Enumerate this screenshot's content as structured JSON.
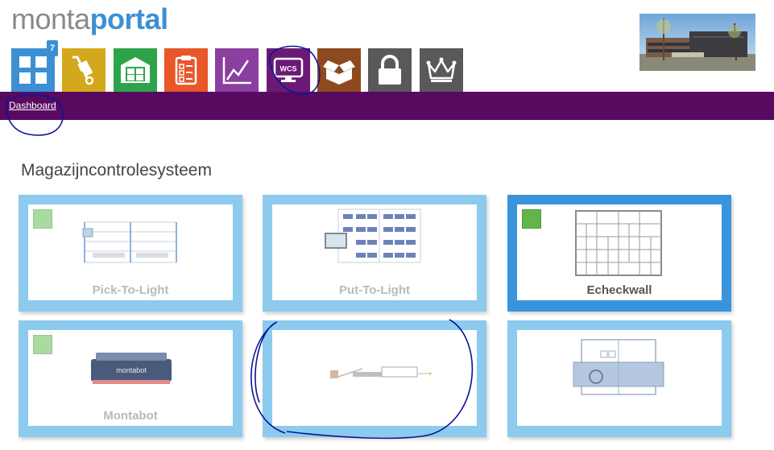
{
  "logo": {
    "part1": "monta",
    "part2": "portal"
  },
  "nav": {
    "badge_count": "7",
    "tiles": [
      {
        "name": "dashboard",
        "icon": "grid-icon",
        "color": "#3d8fd3"
      },
      {
        "name": "inbound",
        "icon": "hand-truck-icon",
        "color": "#d4a81c"
      },
      {
        "name": "warehouse",
        "icon": "warehouse-icon",
        "color": "#2ea44a"
      },
      {
        "name": "orders",
        "icon": "clipboard-checklist-icon",
        "color": "#e8562a"
      },
      {
        "name": "reports",
        "icon": "line-chart-icon",
        "color": "#8b3fa0"
      },
      {
        "name": "wcs",
        "icon": "monitor-wcs-icon",
        "color": "#6a1a75",
        "text": "WCS"
      },
      {
        "name": "packaging",
        "icon": "open-box-icon",
        "color": "#8e4a1e"
      },
      {
        "name": "security",
        "icon": "lock-icon",
        "color": "#595959"
      },
      {
        "name": "premium",
        "icon": "crown-icon",
        "color": "#595959"
      }
    ]
  },
  "breadcrumb": {
    "label": "Dashboard"
  },
  "section": {
    "title": "Magazijncontrolesysteem"
  },
  "cards": [
    {
      "label": "Pick-To-Light",
      "indicator": "inactive"
    },
    {
      "label": "Put-To-Light",
      "indicator": "none"
    },
    {
      "label": "Echeckwall",
      "indicator": "active"
    },
    {
      "label": "Montabot",
      "indicator": "inactive",
      "robot_text": "montabot"
    },
    {
      "label": "",
      "indicator": "none"
    },
    {
      "label": "",
      "indicator": "none"
    }
  ],
  "colors": {
    "nav_bar": "#580a60",
    "card_border": "#8ccaee",
    "card_border_active": "#3a94db",
    "annotation": "#0c1496"
  }
}
